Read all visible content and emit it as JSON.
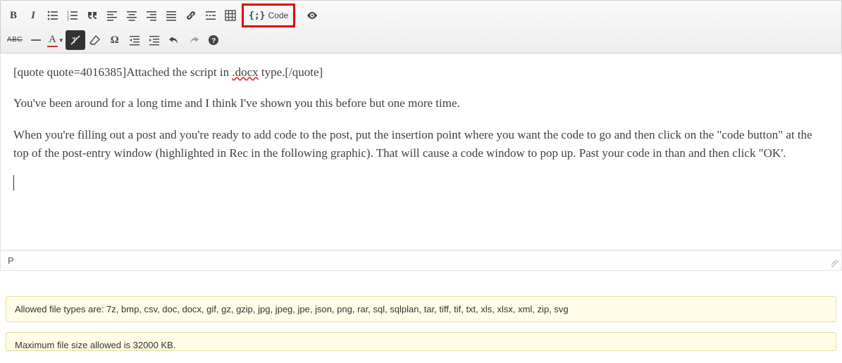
{
  "toolbar": {
    "row1": {
      "bold": "B",
      "italic": "I",
      "code_label": "Code",
      "code_glyph": "{;}"
    },
    "row2": {
      "abc": "ABC",
      "font_a": "A",
      "omega": "Ω"
    }
  },
  "editor": {
    "p1_a": "[quote quote=4016385]Attached the script in ",
    "p1_err": ".docx",
    "p1_b": " type.[/quote]",
    "p2": "You've been around for a long time and I think I've shown you this before but one more time.",
    "p3": "When you're filling out a post and you're ready to add code to the post, put the insertion point where you want the code to go and then click on the \"code button\" at the top of the post-entry window (highlighted in Rec in the following graphic).  That will cause a code window to pop up.  Past your code in than and then click \"OK'."
  },
  "path": "P",
  "notes": {
    "allowed": "Allowed file types are: 7z, bmp, csv, doc, docx, gif, gz, gzip, jpg, jpeg, jpe, json, png, rar, sql, sqlplan, tar, tiff, tif, txt, xls, xlsx, xml, zip, svg",
    "maxsize": "Maximum file size allowed is 32000 KB."
  }
}
